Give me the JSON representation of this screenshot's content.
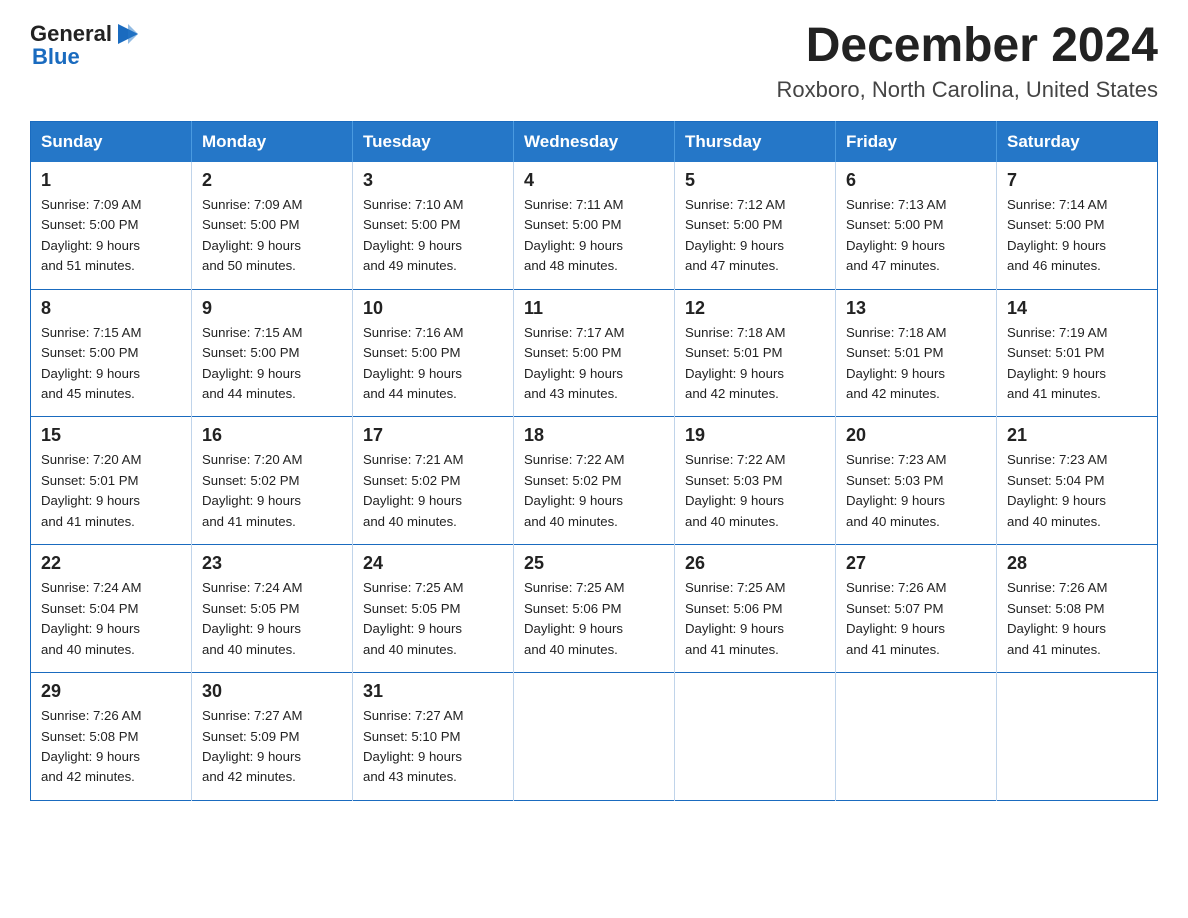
{
  "header": {
    "logo_general": "General",
    "logo_blue": "Blue",
    "title": "December 2024",
    "subtitle": "Roxboro, North Carolina, United States"
  },
  "days_of_week": [
    "Sunday",
    "Monday",
    "Tuesday",
    "Wednesday",
    "Thursday",
    "Friday",
    "Saturday"
  ],
  "weeks": [
    [
      {
        "day": "1",
        "info": "Sunrise: 7:09 AM\nSunset: 5:00 PM\nDaylight: 9 hours\nand 51 minutes."
      },
      {
        "day": "2",
        "info": "Sunrise: 7:09 AM\nSunset: 5:00 PM\nDaylight: 9 hours\nand 50 minutes."
      },
      {
        "day": "3",
        "info": "Sunrise: 7:10 AM\nSunset: 5:00 PM\nDaylight: 9 hours\nand 49 minutes."
      },
      {
        "day": "4",
        "info": "Sunrise: 7:11 AM\nSunset: 5:00 PM\nDaylight: 9 hours\nand 48 minutes."
      },
      {
        "day": "5",
        "info": "Sunrise: 7:12 AM\nSunset: 5:00 PM\nDaylight: 9 hours\nand 47 minutes."
      },
      {
        "day": "6",
        "info": "Sunrise: 7:13 AM\nSunset: 5:00 PM\nDaylight: 9 hours\nand 47 minutes."
      },
      {
        "day": "7",
        "info": "Sunrise: 7:14 AM\nSunset: 5:00 PM\nDaylight: 9 hours\nand 46 minutes."
      }
    ],
    [
      {
        "day": "8",
        "info": "Sunrise: 7:15 AM\nSunset: 5:00 PM\nDaylight: 9 hours\nand 45 minutes."
      },
      {
        "day": "9",
        "info": "Sunrise: 7:15 AM\nSunset: 5:00 PM\nDaylight: 9 hours\nand 44 minutes."
      },
      {
        "day": "10",
        "info": "Sunrise: 7:16 AM\nSunset: 5:00 PM\nDaylight: 9 hours\nand 44 minutes."
      },
      {
        "day": "11",
        "info": "Sunrise: 7:17 AM\nSunset: 5:00 PM\nDaylight: 9 hours\nand 43 minutes."
      },
      {
        "day": "12",
        "info": "Sunrise: 7:18 AM\nSunset: 5:01 PM\nDaylight: 9 hours\nand 42 minutes."
      },
      {
        "day": "13",
        "info": "Sunrise: 7:18 AM\nSunset: 5:01 PM\nDaylight: 9 hours\nand 42 minutes."
      },
      {
        "day": "14",
        "info": "Sunrise: 7:19 AM\nSunset: 5:01 PM\nDaylight: 9 hours\nand 41 minutes."
      }
    ],
    [
      {
        "day": "15",
        "info": "Sunrise: 7:20 AM\nSunset: 5:01 PM\nDaylight: 9 hours\nand 41 minutes."
      },
      {
        "day": "16",
        "info": "Sunrise: 7:20 AM\nSunset: 5:02 PM\nDaylight: 9 hours\nand 41 minutes."
      },
      {
        "day": "17",
        "info": "Sunrise: 7:21 AM\nSunset: 5:02 PM\nDaylight: 9 hours\nand 40 minutes."
      },
      {
        "day": "18",
        "info": "Sunrise: 7:22 AM\nSunset: 5:02 PM\nDaylight: 9 hours\nand 40 minutes."
      },
      {
        "day": "19",
        "info": "Sunrise: 7:22 AM\nSunset: 5:03 PM\nDaylight: 9 hours\nand 40 minutes."
      },
      {
        "day": "20",
        "info": "Sunrise: 7:23 AM\nSunset: 5:03 PM\nDaylight: 9 hours\nand 40 minutes."
      },
      {
        "day": "21",
        "info": "Sunrise: 7:23 AM\nSunset: 5:04 PM\nDaylight: 9 hours\nand 40 minutes."
      }
    ],
    [
      {
        "day": "22",
        "info": "Sunrise: 7:24 AM\nSunset: 5:04 PM\nDaylight: 9 hours\nand 40 minutes."
      },
      {
        "day": "23",
        "info": "Sunrise: 7:24 AM\nSunset: 5:05 PM\nDaylight: 9 hours\nand 40 minutes."
      },
      {
        "day": "24",
        "info": "Sunrise: 7:25 AM\nSunset: 5:05 PM\nDaylight: 9 hours\nand 40 minutes."
      },
      {
        "day": "25",
        "info": "Sunrise: 7:25 AM\nSunset: 5:06 PM\nDaylight: 9 hours\nand 40 minutes."
      },
      {
        "day": "26",
        "info": "Sunrise: 7:25 AM\nSunset: 5:06 PM\nDaylight: 9 hours\nand 41 minutes."
      },
      {
        "day": "27",
        "info": "Sunrise: 7:26 AM\nSunset: 5:07 PM\nDaylight: 9 hours\nand 41 minutes."
      },
      {
        "day": "28",
        "info": "Sunrise: 7:26 AM\nSunset: 5:08 PM\nDaylight: 9 hours\nand 41 minutes."
      }
    ],
    [
      {
        "day": "29",
        "info": "Sunrise: 7:26 AM\nSunset: 5:08 PM\nDaylight: 9 hours\nand 42 minutes."
      },
      {
        "day": "30",
        "info": "Sunrise: 7:27 AM\nSunset: 5:09 PM\nDaylight: 9 hours\nand 42 minutes."
      },
      {
        "day": "31",
        "info": "Sunrise: 7:27 AM\nSunset: 5:10 PM\nDaylight: 9 hours\nand 43 minutes."
      },
      null,
      null,
      null,
      null
    ]
  ]
}
